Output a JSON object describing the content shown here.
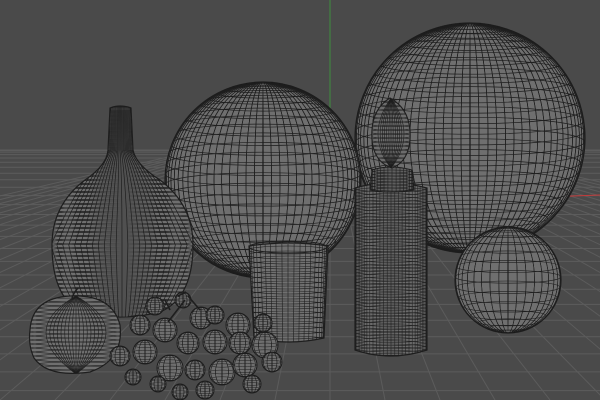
{
  "viewport": {
    "view": "perspective",
    "shading": "wireframe",
    "background_color": "#4a4a4a",
    "grid_color": "#5c5c5c",
    "wire_color": "#1e1e1e",
    "fill_color": "#6f6f6f",
    "axis_x_color": "#c23a3a",
    "axis_y_color": "#3f8f3f"
  },
  "objects": [
    {
      "name": "vase",
      "icon": "vase-wireframe"
    },
    {
      "name": "sphere-middle",
      "icon": "sphere-wireframe"
    },
    {
      "name": "sphere-large",
      "icon": "sphere-wireframe"
    },
    {
      "name": "glass-cup",
      "icon": "cylinder-wireframe"
    },
    {
      "name": "bottle",
      "icon": "bottle-wireframe"
    },
    {
      "name": "orange",
      "icon": "sphere-wireframe"
    },
    {
      "name": "apple",
      "icon": "apple-wireframe"
    },
    {
      "name": "grapes",
      "icon": "grapes-wireframe"
    }
  ]
}
